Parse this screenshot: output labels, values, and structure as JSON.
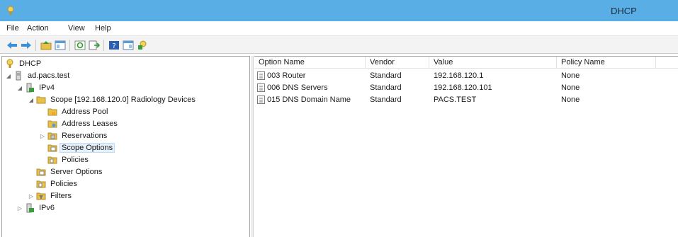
{
  "window": {
    "title": "DHCP"
  },
  "menu": {
    "file": "File",
    "action": "Action",
    "view": "View",
    "help": "Help"
  },
  "toolbar": {
    "buttons": [
      "back-icon",
      "forward-icon",
      "up-folder-icon",
      "show-tree-icon",
      "refresh-icon",
      "export-list-icon",
      "help-icon",
      "properties-icon",
      "dhcp-server-icon"
    ]
  },
  "tree": {
    "root": "DHCP",
    "server": "ad.pacs.test",
    "ipv4": "IPv4",
    "scope": "Scope [192.168.120.0] Radiology Devices",
    "address_pool": "Address Pool",
    "address_leases": "Address Leases",
    "reservations": "Reservations",
    "scope_options": "Scope Options",
    "scope_policies": "Policies",
    "server_options": "Server Options",
    "policies": "Policies",
    "filters": "Filters",
    "ipv6": "IPv6",
    "selected": "Scope Options"
  },
  "list": {
    "columns": [
      "Option Name",
      "Vendor",
      "Value",
      "Policy Name"
    ],
    "rows": [
      {
        "name": "003 Router",
        "vendor": "Standard",
        "value": "192.168.120.1",
        "policy": "None"
      },
      {
        "name": "006 DNS Servers",
        "vendor": "Standard",
        "value": "192.168.120.101",
        "policy": "None"
      },
      {
        "name": "015 DNS Domain Name",
        "vendor": "Standard",
        "value": "PACS.TEST",
        "policy": "None"
      }
    ]
  },
  "colors": {
    "titlebar": "#5aaee6",
    "folder": "#e8c04a",
    "selection": "#e5f0fb"
  }
}
